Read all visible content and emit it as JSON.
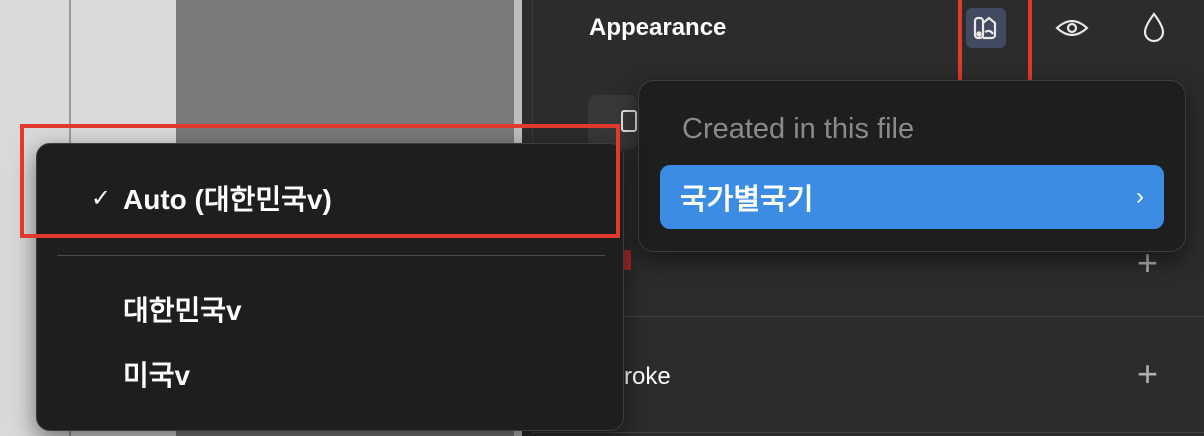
{
  "panel": {
    "title": "Appearance",
    "rows": [
      {
        "label": "roke"
      }
    ]
  },
  "variable_mode_menu": {
    "items": [
      {
        "label": "Auto (대한민국v)",
        "checked": true,
        "check_mark": "✓"
      },
      {
        "label": "대한민국v",
        "checked": false,
        "check_mark": ""
      },
      {
        "label": "미국v",
        "checked": false,
        "check_mark": ""
      }
    ]
  },
  "collections_menu": {
    "section_label": "Created in this file",
    "option": {
      "label": "국가별국기",
      "chevron": "›"
    }
  },
  "icons": {
    "plus": "+"
  },
  "colors": {
    "highlight_blue": "#3d8ce3",
    "annotation_red": "#e03a2f",
    "active_icon_bg": "#414a5e"
  }
}
